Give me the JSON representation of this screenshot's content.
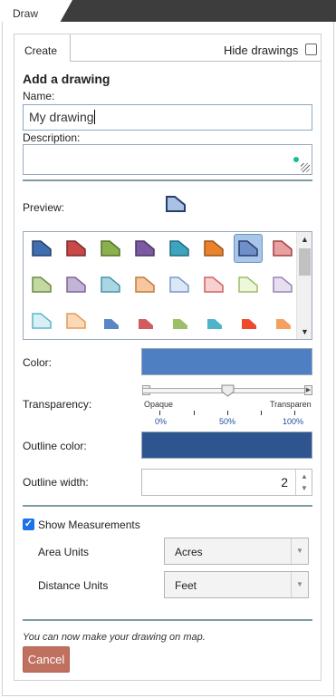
{
  "window": {
    "tab_label": "Draw"
  },
  "panel": {
    "tab_label": "Create",
    "hide_drawings_label": "Hide drawings",
    "heading": "Add a drawing",
    "name_label": "Name:",
    "name_value": "My drawing",
    "description_label": "Description:",
    "preview_label": "Preview:"
  },
  "symbols": {
    "rows": [
      [
        {
          "fill": "#3f6fb0",
          "stroke": "#253f6a"
        },
        {
          "fill": "#c94848",
          "stroke": "#7a2a2a"
        },
        {
          "fill": "#8bb14d",
          "stroke": "#55702a"
        },
        {
          "fill": "#7b5aa1",
          "stroke": "#4a3466"
        },
        {
          "fill": "#3ba5c0",
          "stroke": "#246a7c"
        },
        {
          "fill": "#e9832b",
          "stroke": "#9a5316"
        },
        {
          "fill": "#6e8fc8",
          "stroke": "#253f6a",
          "selected": true
        },
        {
          "fill": "#e8a0a0",
          "stroke": "#a04040"
        }
      ],
      [
        {
          "fill": "#c4d8a4",
          "stroke": "#6d8a45"
        },
        {
          "fill": "#c3b4d6",
          "stroke": "#7a669a"
        },
        {
          "fill": "#a9d6e2",
          "stroke": "#4a93a6"
        },
        {
          "fill": "#f6c79e",
          "stroke": "#c07a3e"
        },
        {
          "fill": "#dbe6f7",
          "stroke": "#7a99cc"
        },
        {
          "fill": "#f7d0d0",
          "stroke": "#d06060"
        },
        {
          "fill": "#eef6dc",
          "stroke": "#9bbf60"
        },
        {
          "fill": "#e7def0",
          "stroke": "#9a84b8"
        }
      ],
      [
        {
          "fill": "#d8f0f5",
          "stroke": "#5ab5c9"
        },
        {
          "fill": "#fbd9b8",
          "stroke": "#e59a54"
        },
        {
          "fill": "#5b86c6",
          "stroke": "#5b86c6",
          "small": true
        },
        {
          "fill": "#d25c5c",
          "stroke": "#d25c5c",
          "small": true
        },
        {
          "fill": "#9cbf68",
          "stroke": "#9cbf68",
          "small": true
        },
        {
          "fill": "#4fb3c9",
          "stroke": "#4fb3c9",
          "small": true
        },
        {
          "fill": "#f04a2e",
          "stroke": "#f04a2e",
          "small": true
        },
        {
          "fill": "#f4a060",
          "stroke": "#f4a060",
          "small": true
        }
      ]
    ]
  },
  "style": {
    "color_label": "Color:",
    "color_value": "#4f7fc3",
    "transparency_label": "Transparency:",
    "transparency_percent": 50,
    "opaque_label": "Opaque",
    "transparent_label": "Transparen",
    "pct_0": "0%",
    "pct_50": "50%",
    "pct_100": "100%",
    "outline_color_label": "Outline color:",
    "outline_color_value": "#2f5590",
    "outline_width_label": "Outline width:",
    "outline_width_value": "2"
  },
  "measurements": {
    "show_label": "Show Measurements",
    "checked": true,
    "area_label": "Area Units",
    "area_value": "Acres",
    "distance_label": "Distance Units",
    "distance_value": "Feet"
  },
  "footer": {
    "note": "You can now make your drawing on map.",
    "cancel_label": "Cancel"
  }
}
